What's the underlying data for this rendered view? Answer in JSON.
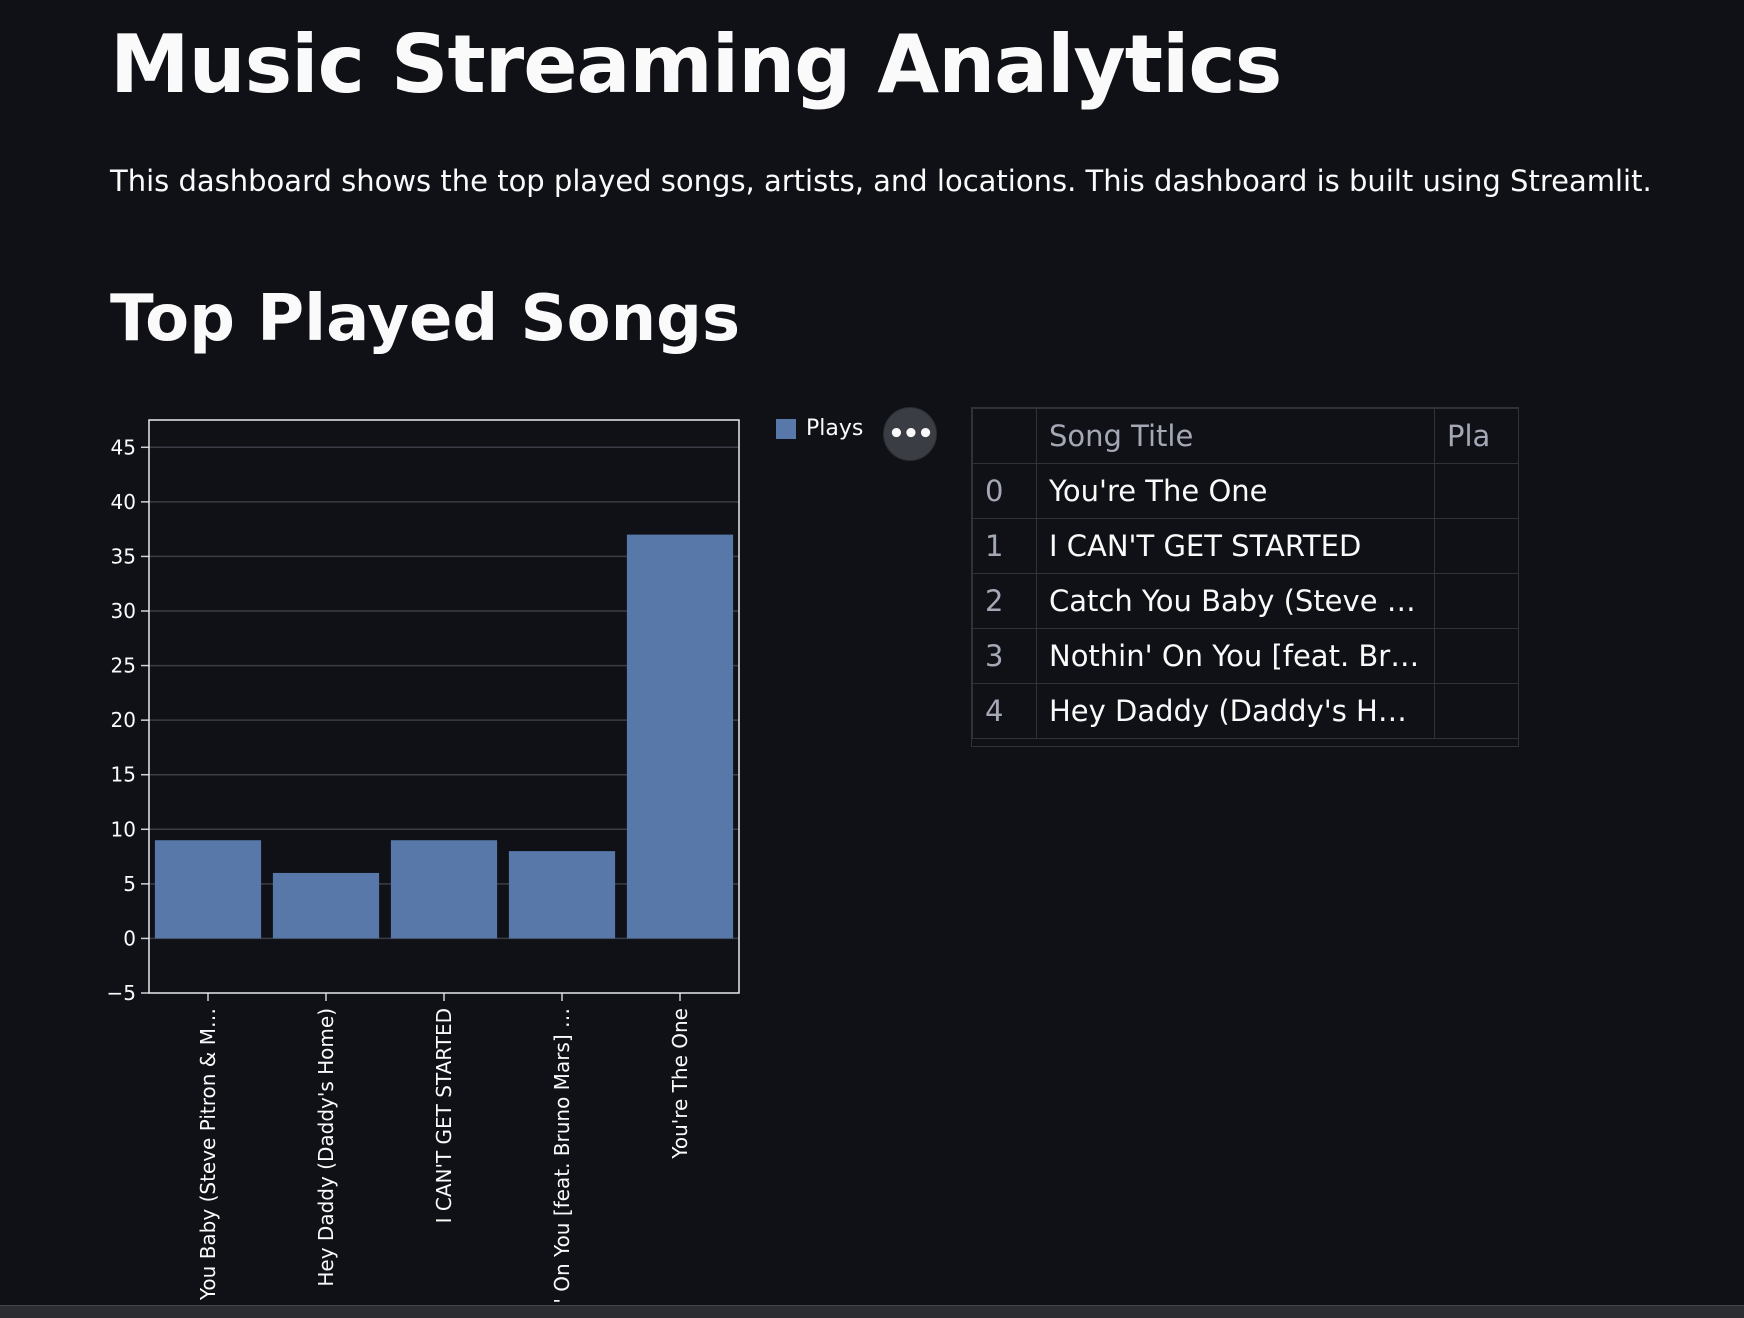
{
  "page": {
    "title": "Music Streaming Analytics",
    "description": "This dashboard shows the top played songs, artists, and locations. This dashboard is built using Streamlit.",
    "section_title": "Top Played Songs"
  },
  "legend": {
    "label": "Plays",
    "color": "#5778a8"
  },
  "more_button": {
    "label": "•••",
    "icon": "more-horizontal-icon"
  },
  "table": {
    "columns": [
      "",
      "Song Title",
      "Pla"
    ],
    "rows": [
      {
        "index": "0",
        "title": "You're The One",
        "plays": ""
      },
      {
        "index": "1",
        "title": "I CAN'T GET STARTED",
        "plays": ""
      },
      {
        "index": "2",
        "title": "Catch You Baby (Steve Pit…",
        "plays": ""
      },
      {
        "index": "3",
        "title": "Nothin' On You [feat. Bru…",
        "plays": ""
      },
      {
        "index": "4",
        "title": "Hey Daddy (Daddy's Home)",
        "plays": ""
      }
    ]
  },
  "colors": {
    "background": "#0f1116",
    "bar": "#5778a8",
    "grid": "#3a3d45",
    "text": "#fafafa"
  },
  "chart_data": {
    "type": "bar",
    "categories": [
      "Catch You Baby (Steve Pitron & M…",
      "Hey Daddy (Daddy's Home)",
      "I CAN'T GET STARTED",
      "Nothin' On You [feat. Bruno Mars] …",
      "You're The One"
    ],
    "tick_labels": [
      "You Baby (Steve Pitron & M…",
      "Hey Daddy (Daddy's Home)",
      "I CAN'T GET STARTED",
      "' On You [feat. Bruno Mars] …",
      "You're The One"
    ],
    "series": [
      {
        "name": "Plays",
        "values": [
          9,
          6,
          9,
          8,
          37
        ]
      }
    ],
    "ylim": [
      -5,
      47.5
    ],
    "yticks": [
      "−5",
      "0",
      "5",
      "10",
      "15",
      "20",
      "25",
      "30",
      "35",
      "40",
      "45"
    ],
    "grid": true,
    "legend_position": "top-right",
    "xlabel": "",
    "ylabel": ""
  }
}
